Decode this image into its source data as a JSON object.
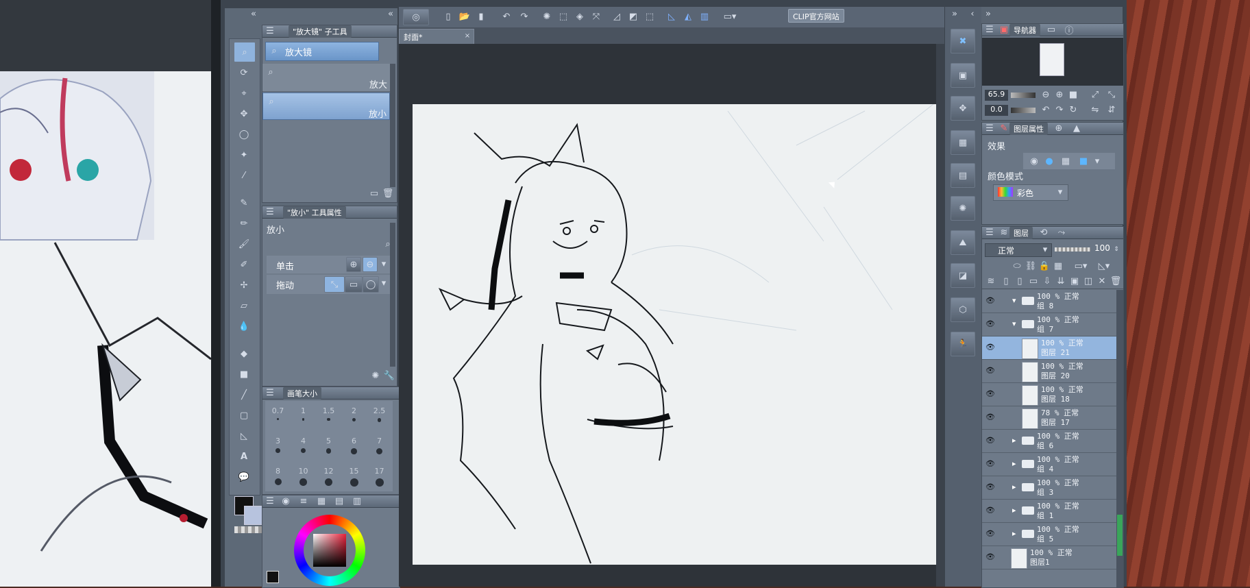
{
  "toolbar": {
    "clip_site_label": "CLIP官方网站"
  },
  "canvas_tab": {
    "label": "封面*"
  },
  "subtool_panel": {
    "header": "\"放大镜\" 子工具",
    "group_label": "放大镜",
    "items": [
      {
        "label": "放大"
      },
      {
        "label": "放小"
      }
    ]
  },
  "tool_property": {
    "header": "\"放小\" 工具属性",
    "tool_name": "放小",
    "click_label": "单击",
    "drag_label": "拖动"
  },
  "brush_size": {
    "header": "画笔大小",
    "sizes": [
      "0.7",
      "1",
      "1.5",
      "2",
      "2.5",
      "3",
      "4",
      "5",
      "6",
      "7",
      "8",
      "10",
      "12",
      "15",
      "17"
    ]
  },
  "navigator": {
    "tab_label": "导航器",
    "zoom_value": "65.9",
    "rotate_value": "0.0"
  },
  "layer_property": {
    "tab_label": "图层属性",
    "effect_label": "效果",
    "color_mode_label": "颜色模式",
    "color_mode_value": "彩色"
  },
  "layers_panel": {
    "tab_label": "图层",
    "blend_mode": "正常",
    "opacity": "100",
    "layers": [
      {
        "line1": "100 % 正常",
        "line2": "组 8",
        "type": "folder-open",
        "selected": false
      },
      {
        "line1": "100 % 正常",
        "line2": "组 7",
        "type": "folder-open",
        "selected": false
      },
      {
        "line1": "100 % 正常",
        "line2": "图层 21",
        "type": "raster",
        "selected": true
      },
      {
        "line1": "100 % 正常",
        "line2": "图层 20",
        "type": "raster",
        "selected": false
      },
      {
        "line1": "100 % 正常",
        "line2": "图层 18",
        "type": "raster",
        "selected": false
      },
      {
        "line1": "78 % 正常",
        "line2": "图层 17",
        "type": "raster",
        "selected": false
      },
      {
        "line1": "100 % 正常",
        "line2": "组 6",
        "type": "folder",
        "selected": false
      },
      {
        "line1": "100 % 正常",
        "line2": "组 4",
        "type": "folder",
        "selected": false
      },
      {
        "line1": "100 % 正常",
        "line2": "组 3",
        "type": "folder",
        "selected": false
      },
      {
        "line1": "100 % 正常",
        "line2": "组 1",
        "type": "folder",
        "selected": false
      },
      {
        "line1": "100 % 正常",
        "line2": "组 5",
        "type": "folder",
        "selected": false
      },
      {
        "line1": "100 % 正常",
        "line2": "图层1",
        "type": "raster",
        "selected": false
      }
    ]
  },
  "colors": {
    "ui_panel": "#5f6b7a",
    "ui_dark": "#3a424c",
    "selection": "#7fa3cf",
    "canvas_paper": "#eef1f2",
    "main_color": "#111111",
    "sub_color": "#b7c3de"
  }
}
